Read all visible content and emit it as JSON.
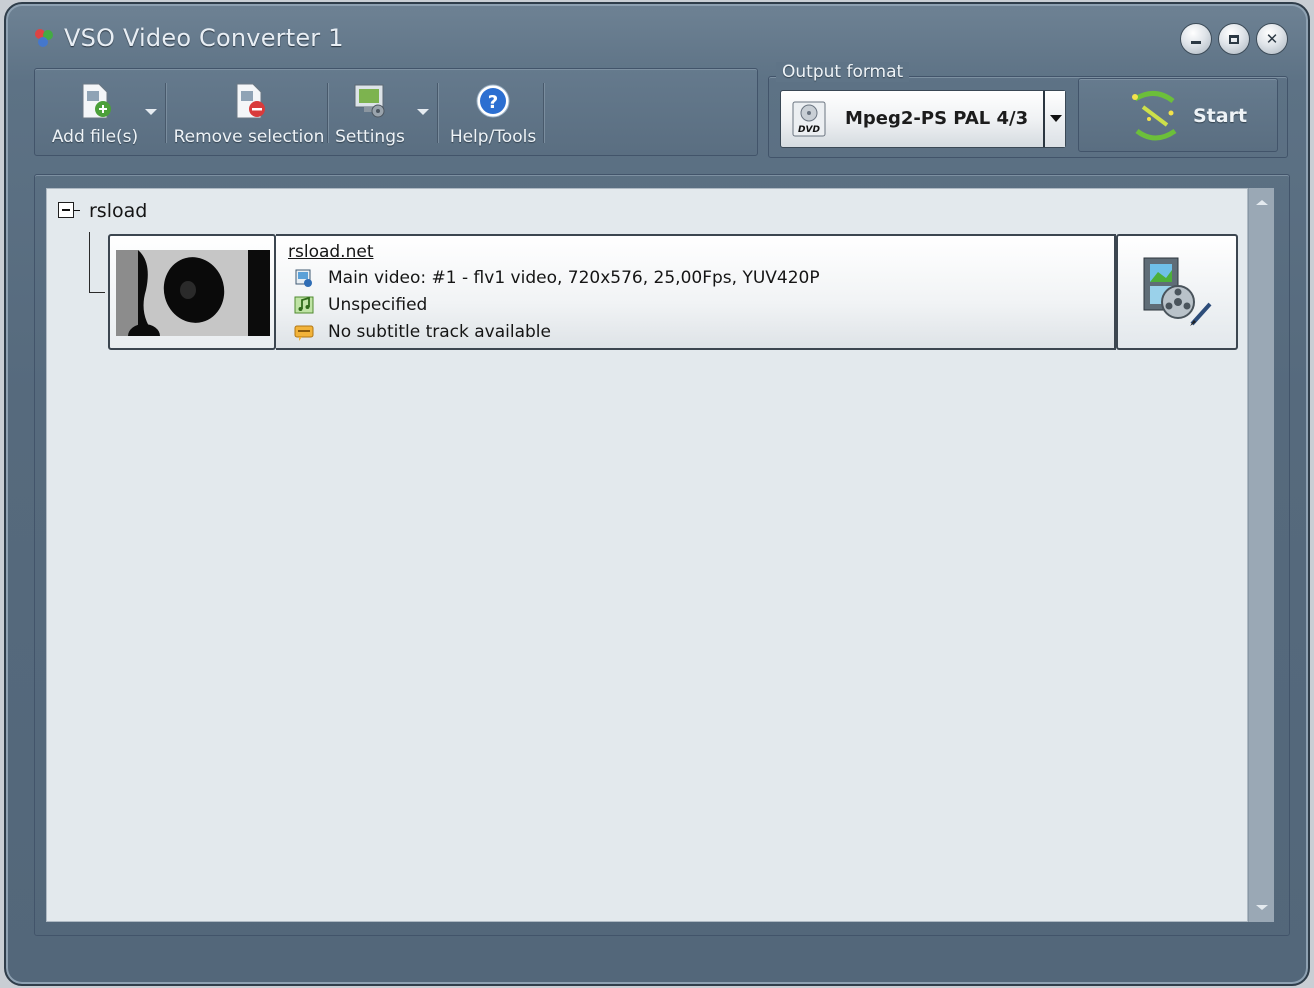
{
  "window": {
    "title": "VSO Video Converter 1",
    "controls": [
      "minimize",
      "maximize",
      "close"
    ]
  },
  "toolbar": {
    "add_files": "Add file(s)",
    "remove_selection": "Remove selection",
    "settings": "Settings",
    "help_tools": "Help/Tools"
  },
  "output": {
    "legend": "Output format",
    "format": "Mpeg2-PS PAL 4/3",
    "start": "Start"
  },
  "tree": {
    "group": "rsload",
    "items": [
      {
        "name": "rsload.net",
        "video": "Main video: #1 - flv1 video, 720x576, 25,00Fps, YUV420P",
        "audio": "Unspecified",
        "subtitle": "No subtitle track available"
      }
    ]
  },
  "colors": {
    "chrome": "#5d7285",
    "list_bg": "#e3e9ed",
    "accent_green": "#5fa83a"
  }
}
